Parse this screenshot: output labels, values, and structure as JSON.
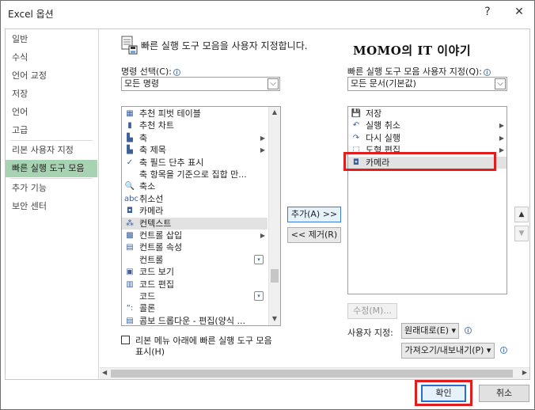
{
  "window": {
    "title": "Excel 옵션",
    "help": "?",
    "close": "✕"
  },
  "sidebar": {
    "items": [
      {
        "label": "일반"
      },
      {
        "label": "수식"
      },
      {
        "label": "언어 교정"
      },
      {
        "label": "저장"
      },
      {
        "label": "언어"
      },
      {
        "label": "고급"
      },
      {
        "label": "리본 사용자 지정"
      },
      {
        "label": "빠른 실행 도구 모음"
      },
      {
        "label": "추가 기능"
      },
      {
        "label": "보안 센터"
      }
    ],
    "active_index": 7
  },
  "main": {
    "header": "빠른 실행 도구 모음을 사용자 지정합니다.",
    "watermark": "MOMO의 IT 이야기",
    "choose_label": "명령 선택(C):",
    "choose_value": "모든 명령",
    "customize_label": "빠른 실행 도구 모음 사용자 지정(Q):",
    "customize_value": "모든 문서(기본값)",
    "left_list": [
      {
        "label": "추천 피벗 테이블",
        "icon": "pivot-icon",
        "glyph": "▦",
        "submenu": false
      },
      {
        "label": "추천 차트",
        "icon": "chart-icon",
        "glyph": "▮",
        "submenu": false
      },
      {
        "label": "축",
        "icon": "axis-icon",
        "glyph": "▙",
        "submenu": true
      },
      {
        "label": "축 제목",
        "icon": "axis-title-icon",
        "glyph": "▙",
        "submenu": true
      },
      {
        "label": "축 필드 단추 표시",
        "icon": "check-icon",
        "glyph": "✓",
        "submenu": false
      },
      {
        "label": "축 항목을 기준으로 집합 만...",
        "icon": "",
        "glyph": "",
        "submenu": false
      },
      {
        "label": "축소",
        "icon": "zoom-out-icon",
        "glyph": "🔍",
        "submenu": false
      },
      {
        "label": "취소선",
        "icon": "strikethrough-icon",
        "glyph": "abc",
        "submenu": false
      },
      {
        "label": "카메라",
        "icon": "camera-icon",
        "glyph": "◘",
        "submenu": false
      },
      {
        "label": "컨텍스트",
        "icon": "context-icon",
        "glyph": "⁂",
        "submenu": false
      },
      {
        "label": "컨트롤 삽입",
        "icon": "insert-control-icon",
        "glyph": "▩",
        "submenu": true
      },
      {
        "label": "컨트롤 속성",
        "icon": "control-properties-icon",
        "glyph": "▤",
        "submenu": false
      },
      {
        "label": "컨트롤",
        "icon": "",
        "glyph": "",
        "submenu": false,
        "dropdown": true
      },
      {
        "label": "코드 보기",
        "icon": "view-code-icon",
        "glyph": "▣",
        "submenu": false
      },
      {
        "label": "코드 편집",
        "icon": "edit-code-icon",
        "glyph": "▥",
        "submenu": false
      },
      {
        "label": "코드",
        "icon": "",
        "glyph": "",
        "submenu": false,
        "dropdown": true
      },
      {
        "label": "콜론",
        "icon": "colon-icon",
        "glyph": "“:",
        "submenu": false
      },
      {
        "label": "콤보 드롭다운 - 편집(양식 ...",
        "icon": "combo-icon",
        "glyph": "▤",
        "submenu": false
      }
    ],
    "left_selected_index": 9,
    "right_list": [
      {
        "label": "저장",
        "icon": "save-icon",
        "glyph": "💾",
        "submenu": false
      },
      {
        "label": "실행 취소",
        "icon": "undo-icon",
        "glyph": "↶",
        "submenu": true
      },
      {
        "label": "다시 실행",
        "icon": "redo-icon",
        "glyph": "↷",
        "submenu": true
      },
      {
        "label": "도형 편집",
        "icon": "edit-shape-icon",
        "glyph": "⬚",
        "submenu": true
      },
      {
        "label": "카메라",
        "icon": "camera-icon",
        "glyph": "◘",
        "submenu": false
      }
    ],
    "right_selected_index": 4,
    "add_button": "추가(A) >>",
    "remove_button": "<< 제거(R)",
    "modify_button": "수정(M)...",
    "custom_label": "사용자 지정:",
    "reset_button": "원래대로(E) ▾",
    "import_export_button": "가져오기/내보내기(P) ▾",
    "checkbox_label_1": "리본 메뉴 아래에 빠른 실행 도구 모음",
    "checkbox_label_2": "표시(H)"
  },
  "footer": {
    "ok": "확인",
    "cancel": "취소"
  }
}
